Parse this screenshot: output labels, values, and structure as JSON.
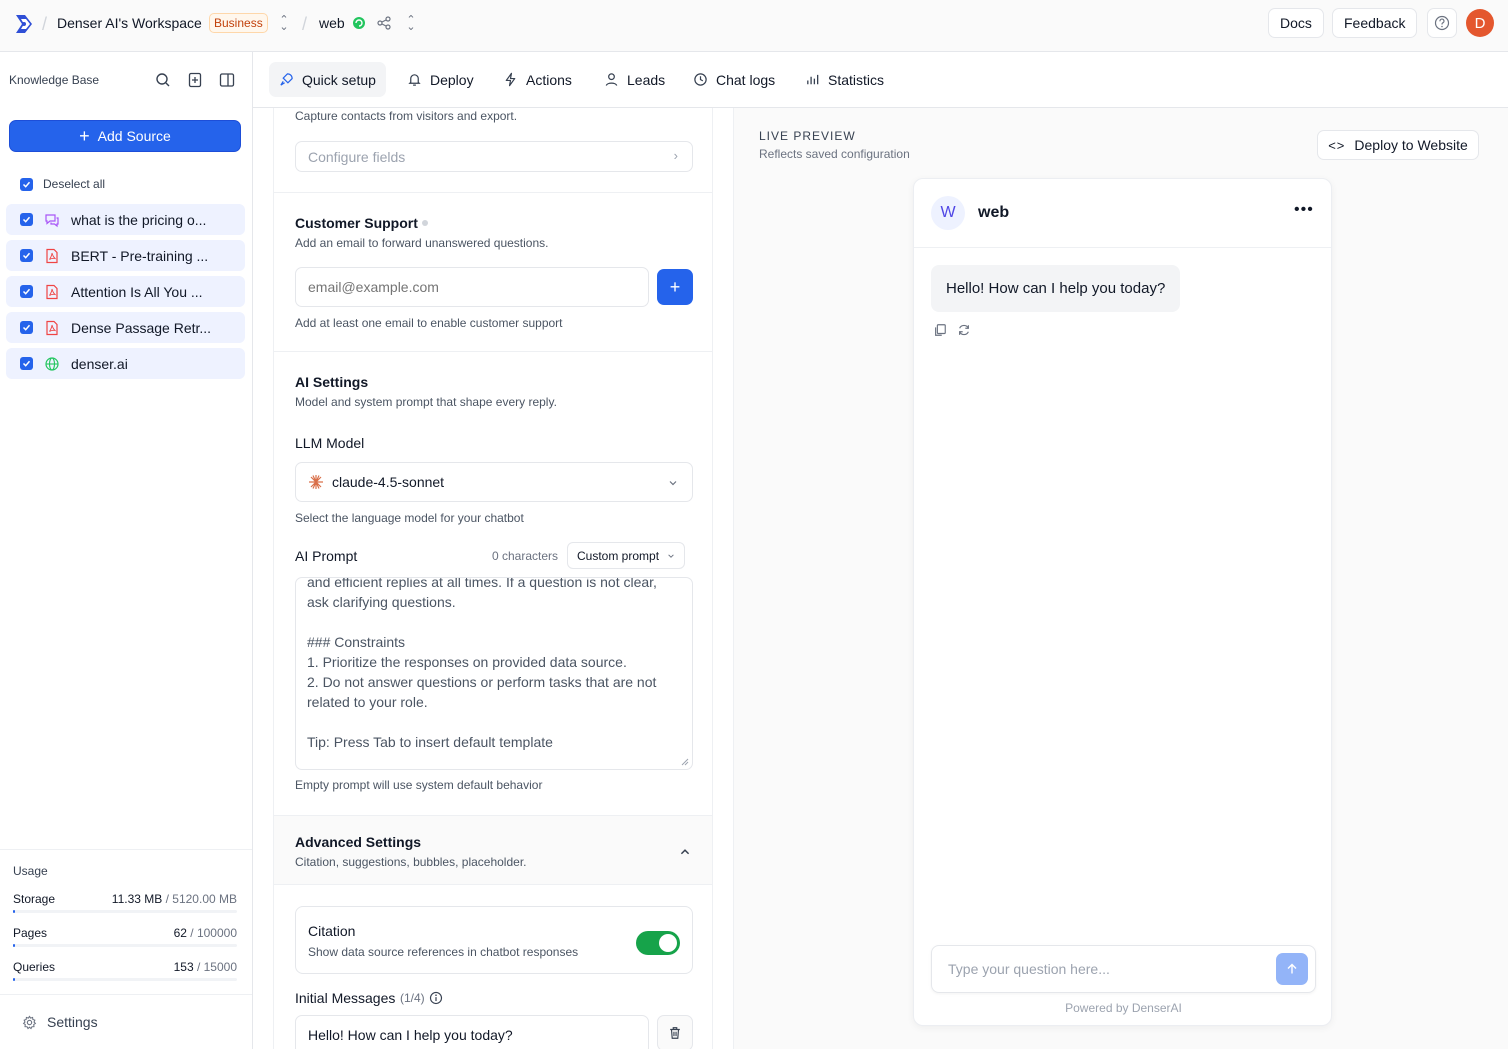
{
  "topbar": {
    "workspace": "Denser AI's Workspace",
    "plan_badge": "Business",
    "project": "web",
    "docs": "Docs",
    "feedback": "Feedback",
    "avatar_initial": "D"
  },
  "sidebar": {
    "title": "Knowledge Base",
    "add_source": "Add Source",
    "deselect_all": "Deselect all",
    "sources": [
      {
        "label": "what is the pricing o...",
        "icon": "chat-icon"
      },
      {
        "label": "BERT - Pre-training ...",
        "icon": "pdf-icon"
      },
      {
        "label": "Attention Is All You ...",
        "icon": "pdf-icon"
      },
      {
        "label": "Dense Passage Retr...",
        "icon": "pdf-icon"
      },
      {
        "label": "denser.ai",
        "icon": "globe-icon"
      }
    ],
    "usage": {
      "title": "Usage",
      "storage": {
        "label": "Storage",
        "used": "11.33 MB",
        "max": " / 5120.00 MB",
        "fraction": 0.0022
      },
      "pages": {
        "label": "Pages",
        "used": "62",
        "max": " / 100000",
        "fraction": 0.0006
      },
      "queries": {
        "label": "Queries",
        "used": "153",
        "max": " / 15000",
        "fraction": 0.0102
      }
    },
    "settings": "Settings"
  },
  "tabs": [
    {
      "label": "Quick setup",
      "active": true
    },
    {
      "label": "Deploy",
      "active": false
    },
    {
      "label": "Actions",
      "active": false
    },
    {
      "label": "Leads",
      "active": false
    },
    {
      "label": "Chat logs",
      "active": false
    },
    {
      "label": "Statistics",
      "active": false
    }
  ],
  "config": {
    "leads_desc": "Capture contacts from visitors and export.",
    "configure_fields": "Configure fields",
    "support": {
      "title": "Customer Support",
      "desc": "Add an email to forward unanswered questions.",
      "email_placeholder": "email@example.com",
      "hint": "Add at least one email to enable customer support"
    },
    "ai": {
      "title": "AI Settings",
      "desc": "Model and system prompt that shape every reply.",
      "llm_label": "LLM Model",
      "model": "claude-4.5-sonnet",
      "model_hint": "Select the language model for your chatbot",
      "prompt_label": "AI Prompt",
      "char_count": "0 characters",
      "prompt_mode": "Custom prompt",
      "prompt_text": "and efficient replies at all times. If a question is not clear, ask clarifying questions.\n\n### Constraints\n1. Prioritize the responses on provided data source.\n2. Do not answer questions or perform tasks that are not related to your role.\n\nTip: Press Tab to insert default template",
      "prompt_hint": "Empty prompt will use system default behavior"
    },
    "advanced": {
      "title": "Advanced Settings",
      "desc": "Citation, suggestions, bubbles, placeholder."
    },
    "citation": {
      "title": "Citation",
      "desc": "Show data source references in chatbot responses",
      "enabled": true
    },
    "initial_messages": {
      "label": "Initial Messages",
      "count": "(1/4)",
      "first": "Hello! How can I help you today?"
    }
  },
  "preview": {
    "title": "LIVE PREVIEW",
    "subtitle": "Reflects saved configuration",
    "deploy_button": "Deploy to Website",
    "bot_initial": "W",
    "bot_name": "web",
    "greeting": "Hello! How can I help you today?",
    "input_placeholder": "Type your question here...",
    "powered_by": "Powered by DenserAI"
  },
  "colors": {
    "accent": "#2563eb",
    "toggle_on": "#16a34a",
    "avatar": "#e4572e"
  }
}
